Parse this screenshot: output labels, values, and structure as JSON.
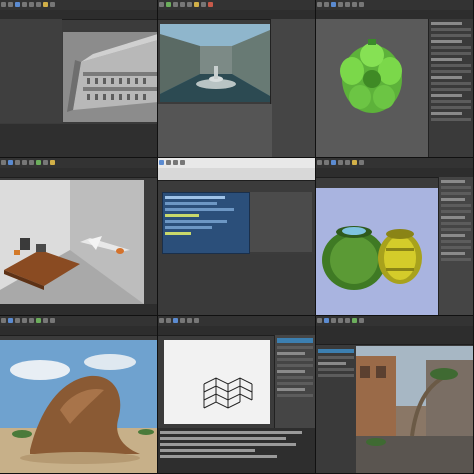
{
  "tiles": [
    {
      "id": "building-viewport",
      "viewport_bg": "#8c8c8c"
    },
    {
      "id": "courtyard-render",
      "viewport_bg": "#4f7f96"
    },
    {
      "id": "green-model-viewport",
      "viewport_bg": "#5a5a5a",
      "accent": "#7bd84a"
    },
    {
      "id": "office-scene-viewport",
      "viewport_bg": "#c9c9c9"
    },
    {
      "id": "script-editor",
      "accent": "#2b4f7a"
    },
    {
      "id": "pots-render",
      "viewport_bg": "#a9b4e0"
    },
    {
      "id": "desert-render",
      "sky": "#6fa2cf",
      "sand": "#c7b089"
    },
    {
      "id": "mesh-viewport",
      "viewport_bg": "#f2f2f2"
    },
    {
      "id": "street-render",
      "viewport_bg": "#8a7766"
    }
  ]
}
